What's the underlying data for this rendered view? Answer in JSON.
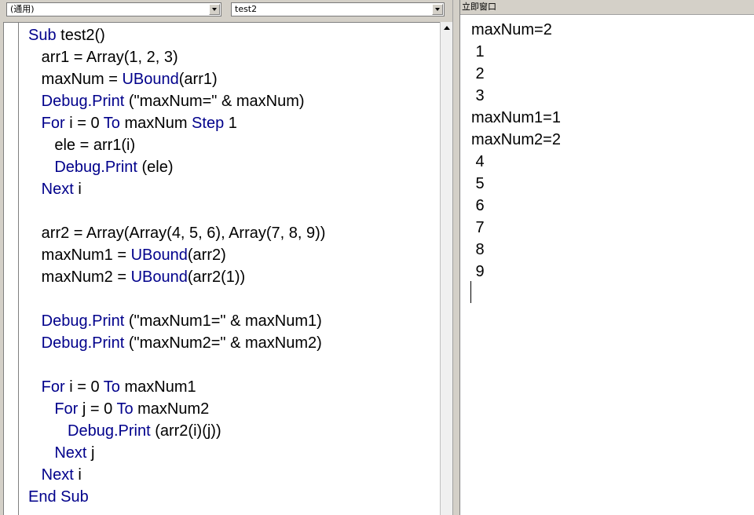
{
  "toolbar": {
    "object_combo": "(通用)",
    "procedure_combo": "test2"
  },
  "immediate_window": {
    "title": "立即窗口",
    "lines": [
      "maxNum=2",
      " 1",
      " 2",
      " 3",
      "maxNum1=1",
      "maxNum2=2",
      " 4",
      " 5",
      " 6",
      " 7",
      " 8",
      " 9"
    ]
  },
  "code": {
    "lines": [
      [
        {
          "t": "Sub",
          "k": 1
        },
        {
          "t": " test2()"
        }
      ],
      [
        {
          "t": "   arr1 = Array(1, 2, 3)"
        }
      ],
      [
        {
          "t": "   maxNum = "
        },
        {
          "t": "UBound",
          "k": 1
        },
        {
          "t": "(arr1)"
        }
      ],
      [
        {
          "t": "   "
        },
        {
          "t": "Debug.Print",
          "k": 1
        },
        {
          "t": " (\"maxNum=\" & maxNum)"
        }
      ],
      [
        {
          "t": "   "
        },
        {
          "t": "For",
          "k": 1
        },
        {
          "t": " i = 0 "
        },
        {
          "t": "To",
          "k": 1
        },
        {
          "t": " maxNum "
        },
        {
          "t": "Step",
          "k": 1
        },
        {
          "t": " 1"
        }
      ],
      [
        {
          "t": "      ele = arr1(i)"
        }
      ],
      [
        {
          "t": "      "
        },
        {
          "t": "Debug.Print",
          "k": 1
        },
        {
          "t": " (ele)"
        }
      ],
      [
        {
          "t": "   "
        },
        {
          "t": "Next",
          "k": 1
        },
        {
          "t": " i"
        }
      ],
      [
        {
          "t": ""
        }
      ],
      [
        {
          "t": "   arr2 = Array(Array(4, 5, 6), Array(7, 8, 9))"
        }
      ],
      [
        {
          "t": "   maxNum1 = "
        },
        {
          "t": "UBound",
          "k": 1
        },
        {
          "t": "(arr2)"
        }
      ],
      [
        {
          "t": "   maxNum2 = "
        },
        {
          "t": "UBound",
          "k": 1
        },
        {
          "t": "(arr2(1))"
        }
      ],
      [
        {
          "t": ""
        }
      ],
      [
        {
          "t": "   "
        },
        {
          "t": "Debug.Print",
          "k": 1
        },
        {
          "t": " (\"maxNum1=\" & maxNum1)"
        }
      ],
      [
        {
          "t": "   "
        },
        {
          "t": "Debug.Print",
          "k": 1
        },
        {
          "t": " (\"maxNum2=\" & maxNum2)"
        }
      ],
      [
        {
          "t": ""
        }
      ],
      [
        {
          "t": "   "
        },
        {
          "t": "For",
          "k": 1
        },
        {
          "t": " i = 0 "
        },
        {
          "t": "To",
          "k": 1
        },
        {
          "t": " maxNum1"
        }
      ],
      [
        {
          "t": "      "
        },
        {
          "t": "For",
          "k": 1
        },
        {
          "t": " j = 0 "
        },
        {
          "t": "To",
          "k": 1
        },
        {
          "t": " maxNum2"
        }
      ],
      [
        {
          "t": "         "
        },
        {
          "t": "Debug.Print",
          "k": 1
        },
        {
          "t": " (arr2(i)(j))"
        }
      ],
      [
        {
          "t": "      "
        },
        {
          "t": "Next",
          "k": 1
        },
        {
          "t": " j"
        }
      ],
      [
        {
          "t": "   "
        },
        {
          "t": "Next",
          "k": 1
        },
        {
          "t": " i"
        }
      ],
      [
        {
          "t": "End Sub",
          "k": 1
        }
      ]
    ]
  },
  "colors": {
    "keyword": "#00008b",
    "text": "#000000",
    "chrome": "#d4d0c8"
  }
}
